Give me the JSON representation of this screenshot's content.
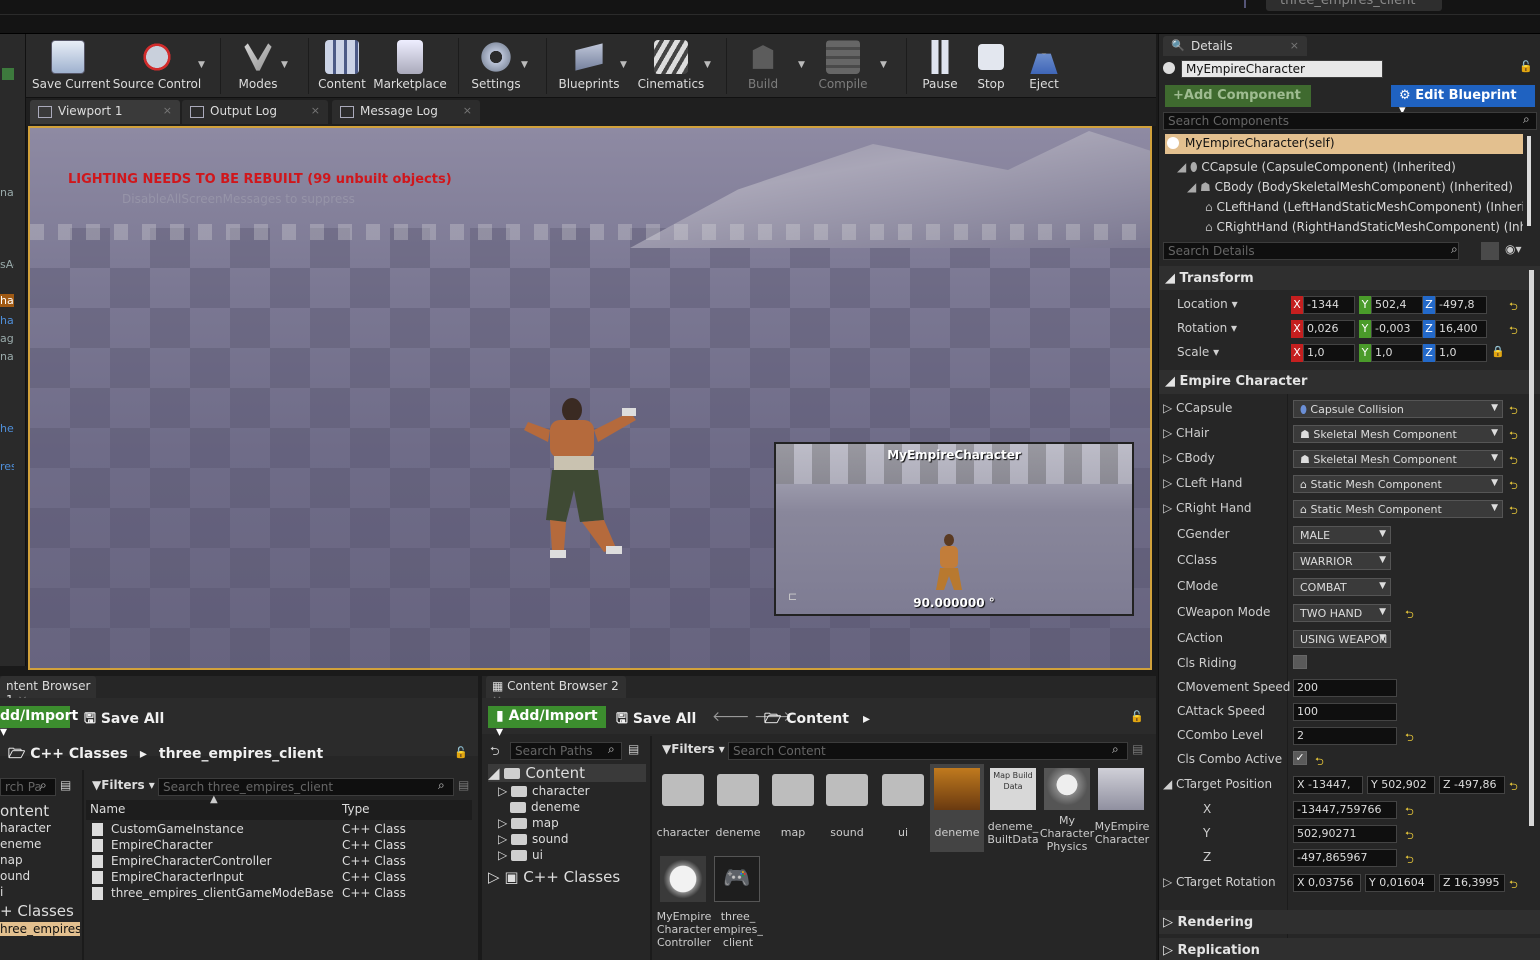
{
  "window": {
    "project_tab": "three_empires_client"
  },
  "left_strip": {
    "labels": [
      "na",
      "sAc",
      "ha",
      "ha",
      "ag",
      "na",
      "he",
      "res"
    ]
  },
  "toolbar": {
    "items": [
      {
        "label": "Save Current",
        "icon": "save-icon"
      },
      {
        "label": "Source Control",
        "icon": "source-control-icon"
      },
      {
        "label": "Modes",
        "icon": "modes-icon"
      },
      {
        "label": "Content",
        "icon": "content-icon"
      },
      {
        "label": "Marketplace",
        "icon": "marketplace-icon"
      },
      {
        "label": "Settings",
        "icon": "settings-icon"
      },
      {
        "label": "Blueprints",
        "icon": "blueprints-icon"
      },
      {
        "label": "Cinematics",
        "icon": "cinematics-icon"
      },
      {
        "label": "Build",
        "icon": "build-icon"
      },
      {
        "label": "Compile",
        "icon": "compile-icon"
      },
      {
        "label": "Pause",
        "icon": "pause-icon"
      },
      {
        "label": "Stop",
        "icon": "stop-icon"
      },
      {
        "label": "Eject",
        "icon": "eject-icon"
      }
    ]
  },
  "viewport_tabs": [
    "Viewport 1",
    "Output Log",
    "Message Log"
  ],
  "viewport": {
    "warning": "LIGHTING NEEDS TO BE REBUILT (99 unbuilt objects)",
    "subwarning": "DisableAllScreenMessages to suppress",
    "preview_title": "MyEmpireCharacter",
    "preview_angle": "90.000000 °"
  },
  "details": {
    "tab": "Details",
    "name": "MyEmpireCharacter",
    "add_component": "+Add Component",
    "edit_blueprint": "Edit Blueprint",
    "search_components": "Search Components",
    "self_item": "MyEmpireCharacter(self)",
    "tree": [
      "CCapsule (CapsuleComponent) (Inherited)",
      "CBody (BodySkeletalMeshComponent) (Inherited)",
      "CLeftHand (LeftHandStaticMeshComponent) (Inherited)",
      "CRightHand (RightHandStaticMeshComponent) (Inherited)"
    ],
    "search_details": "Search Details",
    "transform": {
      "title": "Transform",
      "location": {
        "label": "Location",
        "x": "-1344",
        "y": "502,4",
        "z": "-497,8"
      },
      "rotation": {
        "label": "Rotation",
        "x": "0,026",
        "y": "-0,003",
        "z": "16,400"
      },
      "scale": {
        "label": "Scale",
        "x": "1,0",
        "y": "1,0",
        "z": "1,0"
      }
    },
    "empire": {
      "title": "Empire Character",
      "ccapsule": {
        "label": "CCapsule",
        "value": "Capsule Collision"
      },
      "chair": {
        "label": "CHair",
        "value": "Skeletal Mesh Component"
      },
      "cbody": {
        "label": "CBody",
        "value": "Skeletal Mesh Component"
      },
      "cleft": {
        "label": "CLeft Hand",
        "value": "Static Mesh Component"
      },
      "cright": {
        "label": "CRight Hand",
        "value": "Static Mesh Component"
      },
      "cgender": {
        "label": "CGender",
        "value": "MALE"
      },
      "cclass": {
        "label": "CClass",
        "value": "WARRIOR"
      },
      "cmode": {
        "label": "CMode",
        "value": "COMBAT"
      },
      "cweapon": {
        "label": "CWeapon Mode",
        "value": "TWO HAND"
      },
      "caction": {
        "label": "CAction",
        "value": "USING WEAPON"
      },
      "riding": {
        "label": "Cls Riding",
        "checked": false
      },
      "movespeed": {
        "label": "CMovement Speed",
        "value": "200"
      },
      "attackspeed": {
        "label": "CAttack Speed",
        "value": "100"
      },
      "combolevel": {
        "label": "CCombo Level",
        "value": "2"
      },
      "comboactive": {
        "label": "Cls Combo Active",
        "checked": true
      },
      "targetpos": {
        "label": "CTarget Position",
        "x": "-13447,",
        "y": "502,902",
        "z": "-497,86",
        "xl": "X",
        "yl": "Y",
        "zl": "Z",
        "xv": "-13447,759766",
        "yv": "502,90271",
        "zv": "-497,865967"
      },
      "targetrot": {
        "label": "CTarget Rotation",
        "x": "0,03756",
        "y": "0,01604",
        "z": "16,3995"
      }
    },
    "rendering": "Rendering",
    "replication": "Replication"
  },
  "cb1": {
    "tab": "ntent Browser 1",
    "add_import": "dd/Import",
    "save_all": "Save All",
    "breadcrumb": [
      "C++ Classes",
      "three_empires_client"
    ],
    "search_paths": "rch Pa",
    "filters": "Filters",
    "search": "Search three_empires_client",
    "tree": [
      "ontent",
      "haracter",
      "eneme",
      "nap",
      "ound",
      "i",
      "+ Classes",
      "hree_empires_"
    ],
    "col_name": "Name",
    "col_type": "Type",
    "rows": [
      {
        "name": "CustomGameInstance",
        "type": "C++ Class"
      },
      {
        "name": "EmpireCharacter",
        "type": "C++ Class"
      },
      {
        "name": "EmpireCharacterController",
        "type": "C++ Class"
      },
      {
        "name": "EmpireCharacterInput",
        "type": "C++ Class"
      },
      {
        "name": "three_empires_clientGameModeBase",
        "type": "C++ Class"
      }
    ]
  },
  "cb2": {
    "tab": "Content Browser 2",
    "add_import": "Add/Import",
    "save_all": "Save All",
    "path": "Content",
    "search_paths": "Search Paths",
    "filters": "Filters",
    "search": "Search Content",
    "tree_root": "Content",
    "tree": [
      "character",
      "deneme",
      "map",
      "sound",
      "ui"
    ],
    "cpp": "C++ Classes",
    "tiles": [
      {
        "label": "character",
        "kind": "folder"
      },
      {
        "label": "deneme",
        "kind": "folder"
      },
      {
        "label": "map",
        "kind": "folder"
      },
      {
        "label": "sound",
        "kind": "folder"
      },
      {
        "label": "ui",
        "kind": "folder"
      },
      {
        "label": "deneme",
        "kind": "level"
      },
      {
        "label": "deneme_ BuiltData",
        "kind": "data",
        "thumb": "Map Build Data"
      },
      {
        "label": "My Character Physics",
        "kind": "physics"
      },
      {
        "label": "MyEmpire Character",
        "kind": "blueprint"
      },
      {
        "label": "MyEmpire Character Controller",
        "kind": "sphere"
      },
      {
        "label": "three_ empires_ client",
        "kind": "gamepad"
      }
    ]
  }
}
